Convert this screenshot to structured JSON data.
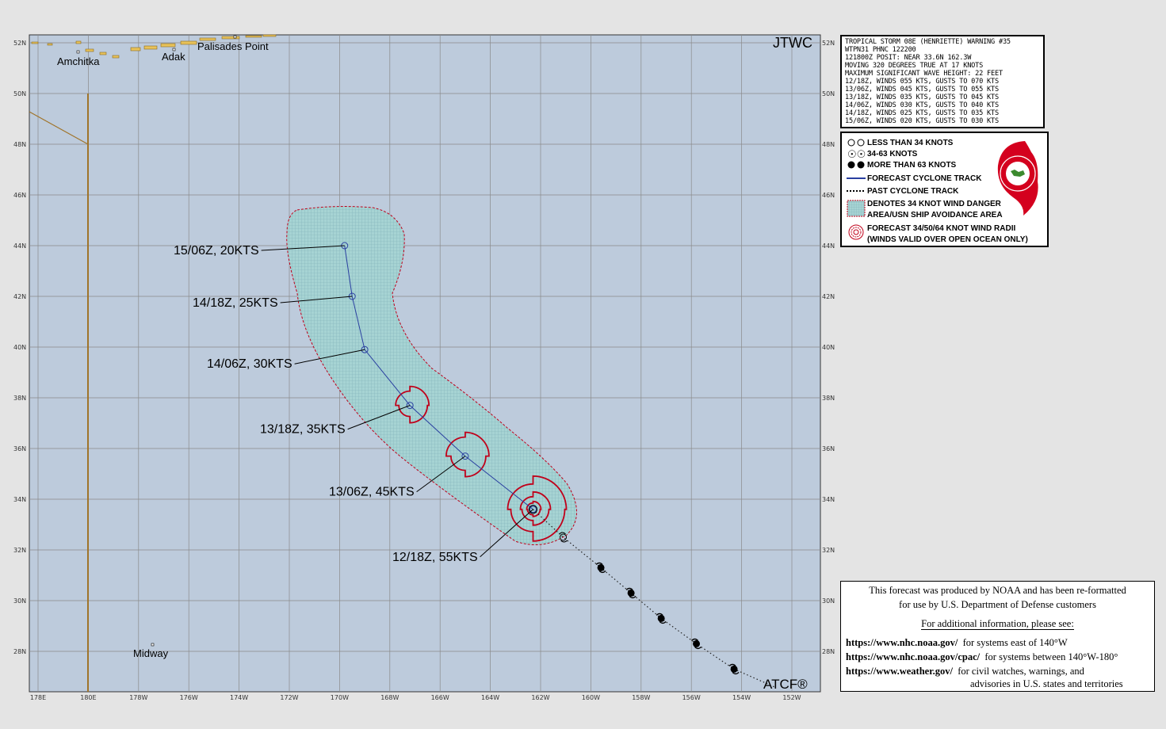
{
  "header": {
    "agency": "JTWC",
    "footer_logo": "ATCF®"
  },
  "warning": {
    "lines": [
      "TROPICAL STORM 08E (HENRIETTE) WARNING #35",
      "WTPN31 PHNC 122200",
      "121800Z POSIT: NEAR 33.6N 162.3W",
      "MOVING 320 DEGREES TRUE AT 17 KNOTS",
      "MAXIMUM SIGNIFICANT WAVE HEIGHT: 22 FEET",
      "12/18Z, WINDS 055 KTS, GUSTS TO 070 KTS",
      "13/06Z, WINDS 045 KTS, GUSTS TO 055 KTS",
      "13/18Z, WINDS 035 KTS, GUSTS TO 045 KTS",
      "14/06Z, WINDS 030 KTS, GUSTS TO 040 KTS",
      "14/18Z, WINDS 025 KTS, GUSTS TO 035 KTS",
      "15/06Z, WINDS 020 KTS, GUSTS TO 030 KTS"
    ]
  },
  "legend": {
    "items": [
      {
        "icon": "less-than-34-knots-icon",
        "label": "LESS THAN 34 KNOTS"
      },
      {
        "icon": "34-63-knots-icon",
        "label": "34-63 KNOTS"
      },
      {
        "icon": "more-than-63-knots-icon",
        "label": "MORE THAN 63 KNOTS"
      },
      {
        "icon": "forecast-track-line-icon",
        "label": "FORECAST CYCLONE TRACK"
      },
      {
        "icon": "past-track-dotted-icon",
        "label": "PAST CYCLONE TRACK"
      },
      {
        "icon": "danger-area-hatch-icon",
        "label": "DENOTES 34 KNOT WIND DANGER"
      },
      {
        "icon": "",
        "label": "AREA/USN SHIP AVOIDANCE AREA"
      },
      {
        "icon": "wind-radii-icon",
        "label": "FORECAST 34/50/64 KNOT WIND RADII"
      },
      {
        "icon": "",
        "label": "(WINDS VALID OVER OPEN OCEAN ONLY)"
      }
    ],
    "colors": {
      "track": "#2a3fa0",
      "radii": "#c0001a",
      "danger_fill": "#9ecdcf",
      "ocean": "#bdcbdc"
    }
  },
  "info": {
    "line1": "This forecast was produced by NOAA and has been re-formatted",
    "line2": "for use by U.S. Department of Defense customers",
    "line3": "For additional information, please see:",
    "links": [
      {
        "url": "https://www.nhc.noaa.gov/",
        "desc": "for systems east of 140°W"
      },
      {
        "url": "https://www.nhc.noaa.gov/cpac/",
        "desc": "for systems between 140°W-180°"
      },
      {
        "url": "https://www.weather.gov/",
        "desc": "for civil watches, warnings, and"
      }
    ],
    "line_last": "advisories in U.S. states and territories"
  },
  "map": {
    "lat_labels": [
      "52N",
      "50N",
      "48N",
      "46N",
      "44N",
      "42N",
      "40N",
      "38N",
      "36N",
      "34N",
      "32N",
      "30N",
      "28N"
    ],
    "lon_labels": [
      "178E",
      "180E",
      "178W",
      "176W",
      "174W",
      "172W",
      "170W",
      "168W",
      "166W",
      "164W",
      "162W",
      "160W",
      "158W",
      "156W",
      "154W",
      "152W"
    ],
    "places": [
      "Amchitka",
      "Adak",
      "Palisades Point",
      "Midway"
    ],
    "forecast_points": [
      {
        "label": "12/18Z,  55KTS",
        "lat": 33.6,
        "lon": -162.3
      },
      {
        "label": "13/06Z,  45KTS",
        "lat": 35.7,
        "lon": -165.0
      },
      {
        "label": "13/18Z,  35KTS",
        "lat": 37.7,
        "lon": -167.2
      },
      {
        "label": "14/06Z,  30KTS",
        "lat": 39.9,
        "lon": -169.0
      },
      {
        "label": "14/18Z,  25KTS",
        "lat": 42.0,
        "lon": -169.5
      },
      {
        "label": "15/06Z,  20KTS",
        "lat": 44.0,
        "lon": -169.8
      }
    ],
    "past_points": [
      {
        "lat": 32.5,
        "lon": -161.1,
        "class": "34-63"
      },
      {
        "lat": 31.3,
        "lon": -159.6,
        "class": "64+"
      },
      {
        "lat": 30.3,
        "lon": -158.4,
        "class": "64+"
      },
      {
        "lat": 29.3,
        "lon": -157.2,
        "class": "64+"
      },
      {
        "lat": 28.3,
        "lon": -155.8,
        "class": "64+"
      },
      {
        "lat": 27.3,
        "lon": -154.3,
        "class": "64+"
      },
      {
        "lat": 26.6,
        "lon": -152.7,
        "class": ""
      }
    ]
  }
}
